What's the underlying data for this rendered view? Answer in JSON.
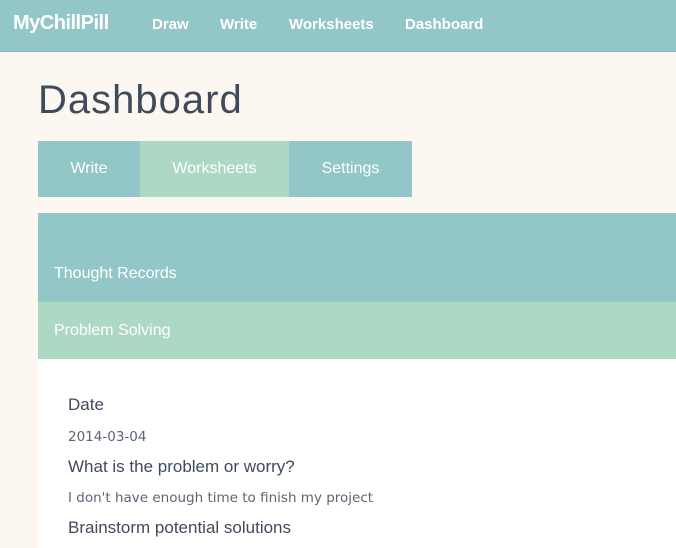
{
  "header": {
    "brand": "MyChillPill",
    "nav": [
      {
        "label": "Draw"
      },
      {
        "label": "Write"
      },
      {
        "label": "Worksheets"
      },
      {
        "label": "Dashboard"
      }
    ]
  },
  "main": {
    "title": "Dashboard",
    "tabs": [
      {
        "label": "Write",
        "active": false
      },
      {
        "label": "Worksheets",
        "active": true
      },
      {
        "label": "Settings",
        "active": false
      }
    ],
    "sections": [
      {
        "label": "Thought Records"
      },
      {
        "label": "Problem Solving"
      }
    ],
    "form": {
      "date_label": "Date",
      "date_value": "2014-03-04",
      "problem_label": "What is the problem or worry?",
      "problem_value": "I don't have enough time to finish my project",
      "brainstorm_label": "Brainstorm potential solutions"
    }
  },
  "colors": {
    "teal": "#93c6c7",
    "mint": "#acd8c4",
    "background": "#fdf7f1",
    "text": "#3f4b5a"
  }
}
